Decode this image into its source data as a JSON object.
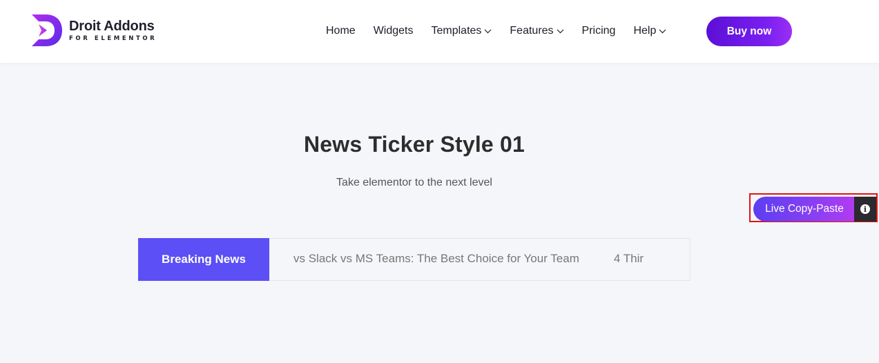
{
  "brand": {
    "name": "Droit Addons",
    "tagline": "FOR ELEMENTOR"
  },
  "nav": {
    "items": [
      {
        "label": "Home",
        "dropdown": false
      },
      {
        "label": "Widgets",
        "dropdown": false
      },
      {
        "label": "Templates",
        "dropdown": true
      },
      {
        "label": "Features",
        "dropdown": true
      },
      {
        "label": "Pricing",
        "dropdown": false
      },
      {
        "label": "Help",
        "dropdown": true
      }
    ],
    "cta_label": "Buy now"
  },
  "main": {
    "title": "News Ticker Style 01",
    "subtitle": "Take elementor to the next level"
  },
  "copy_paste": {
    "label": "Live Copy-Paste",
    "info_icon": "info-icon"
  },
  "ticker": {
    "label": "Breaking News",
    "items": [
      "vs Slack vs MS Teams: The Best Choice for Your Team",
      "4 Thir"
    ]
  },
  "colors": {
    "accent": "#5b4ff5",
    "cta_gradient_start": "#5b0fd6",
    "highlight_border": "#e31212",
    "page_bg": "#f4f6f9"
  }
}
